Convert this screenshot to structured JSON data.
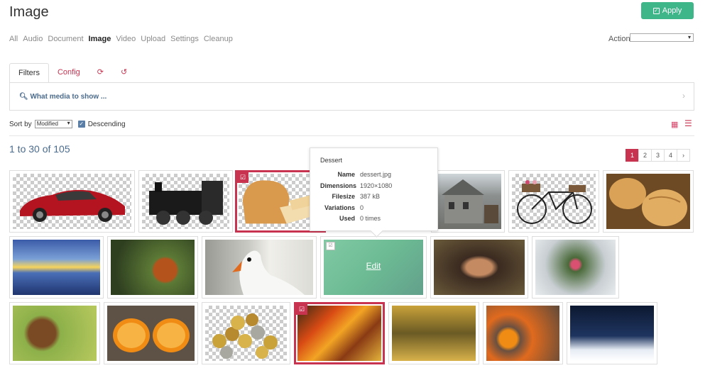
{
  "header": {
    "title": "Image",
    "apply_label": "Apply"
  },
  "nav": {
    "items": [
      "All",
      "Audio",
      "Document",
      "Image",
      "Video",
      "Upload",
      "Settings",
      "Cleanup"
    ],
    "active": "Image"
  },
  "action": {
    "label": "Action",
    "selected": ""
  },
  "tabs": {
    "filters": "Filters",
    "config": "Config"
  },
  "filter_panel": {
    "what_media": "What media to show ..."
  },
  "sort": {
    "label": "Sort by",
    "selected": "Modified",
    "descending_label": "Descending",
    "descending_checked": true
  },
  "results": {
    "count_text": "1 to 30 of 105"
  },
  "pagination": {
    "pages": [
      "1",
      "2",
      "3",
      "4"
    ],
    "current": "1",
    "next": "›"
  },
  "tooltip": {
    "title": "Dessert",
    "rows": [
      {
        "k": "Name",
        "v": "dessert.jpg"
      },
      {
        "k": "Dimensions",
        "v": "1920×1080"
      },
      {
        "k": "Filesize",
        "v": "387 kB"
      },
      {
        "k": "Variations",
        "v": "0"
      },
      {
        "k": "Used",
        "v": "0 times"
      }
    ]
  },
  "thumbnails": [
    {
      "name": "red-sports-car",
      "selected": false
    },
    {
      "name": "steam-locomotive",
      "selected": false
    },
    {
      "name": "bread-loaf",
      "selected": true
    },
    {
      "name": "stone-house",
      "selected": false
    },
    {
      "name": "bicycle-with-flowers",
      "selected": false
    },
    {
      "name": "bread-rolls",
      "selected": false
    },
    {
      "name": "sunset-pier",
      "selected": false
    },
    {
      "name": "squirrel",
      "selected": false
    },
    {
      "name": "swan",
      "selected": false
    },
    {
      "name": "dessert",
      "selected": false,
      "hover_label": "Edit"
    },
    {
      "name": "woman-portrait",
      "selected": false
    },
    {
      "name": "flower-basket-snow",
      "selected": false
    },
    {
      "name": "jumping-spider",
      "selected": false
    },
    {
      "name": "orange-halves",
      "selected": false
    },
    {
      "name": "coins",
      "selected": false
    },
    {
      "name": "abstract-painting",
      "selected": true
    },
    {
      "name": "autumn-avenue",
      "selected": false
    },
    {
      "name": "fruit-faces",
      "selected": false
    },
    {
      "name": "snowy-forest",
      "selected": false
    }
  ]
}
